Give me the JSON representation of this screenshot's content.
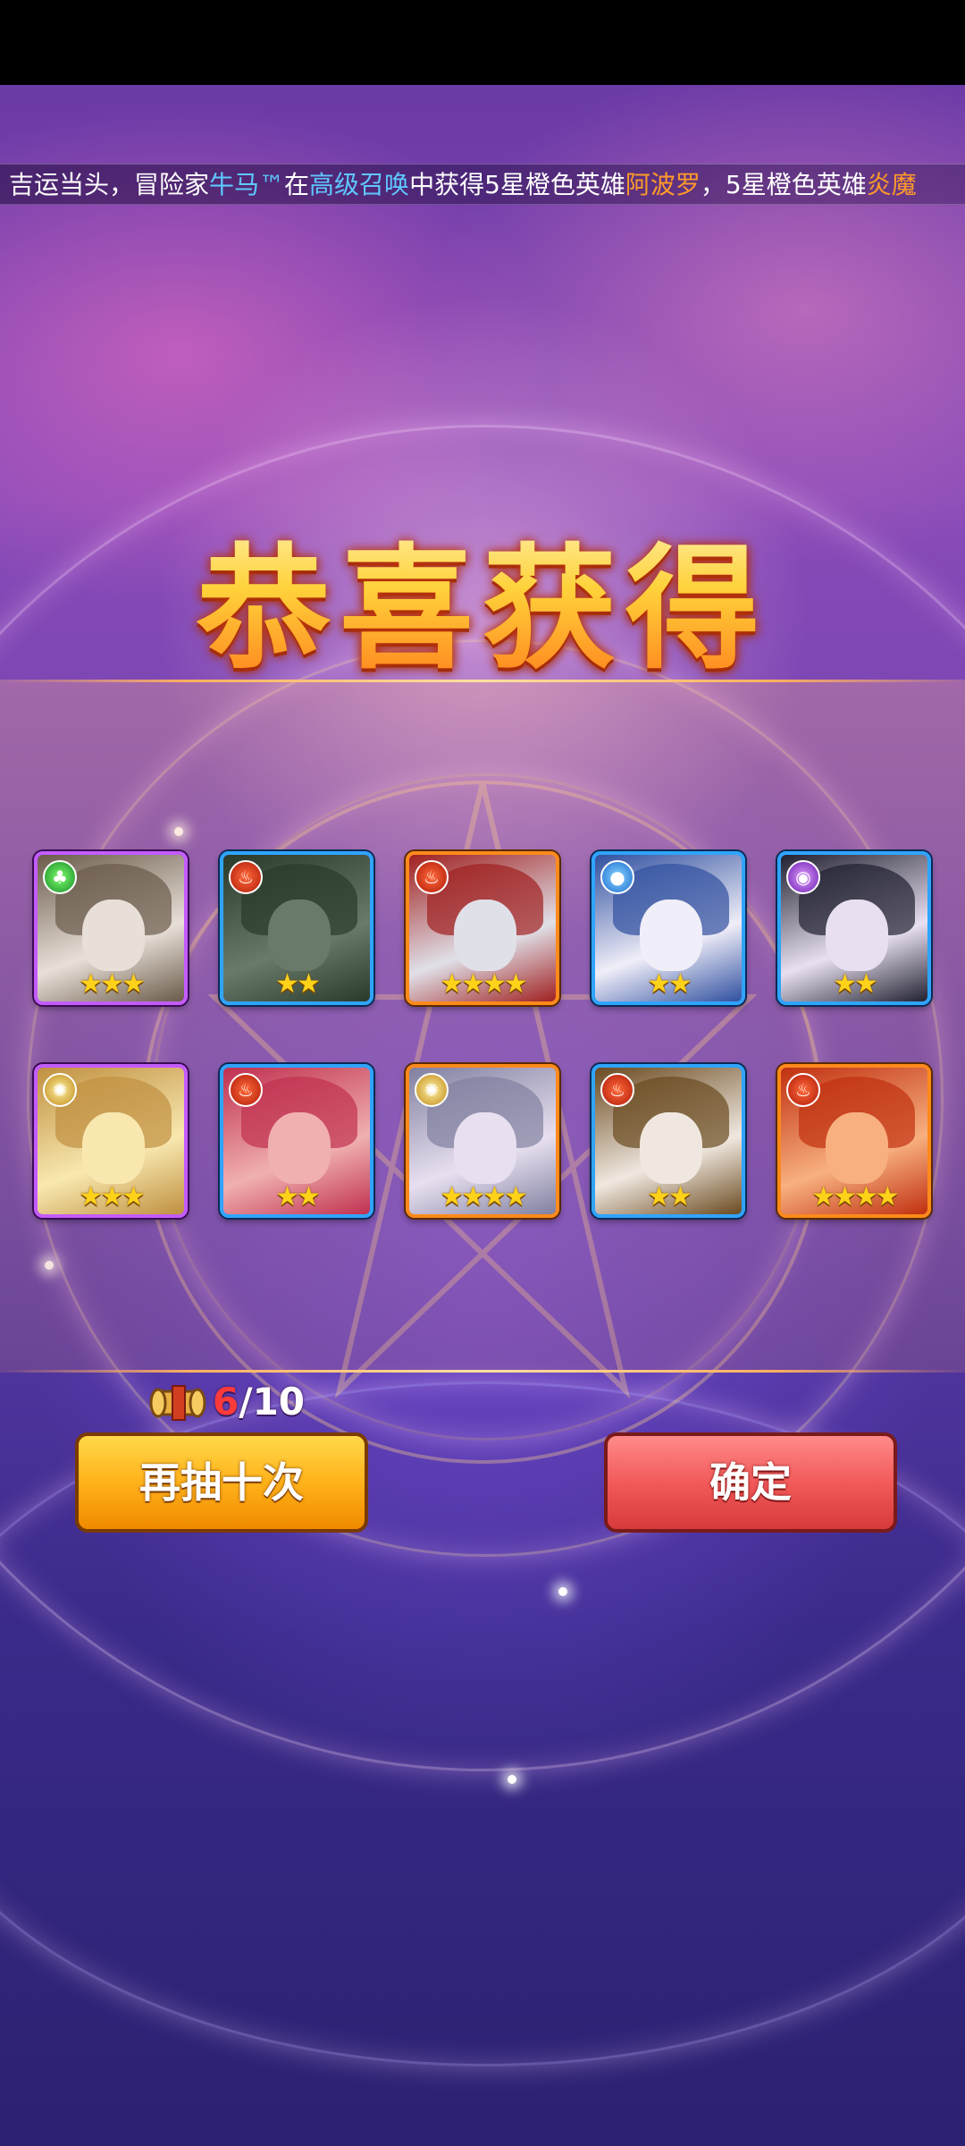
{
  "ticker": {
    "part1": "吉运当头，冒险家",
    "player": "牛马™",
    "part2": "在",
    "pool": "高级召唤",
    "part3": "中获得5星橙色英雄",
    "hero1": "阿波罗",
    "part4": "，5星橙色英雄",
    "hero2": "炎魔"
  },
  "title": "恭喜获得",
  "heroes": [
    {
      "element": "nature-icon",
      "frame": "purple",
      "stars": "★★★",
      "star_count": 3
    },
    {
      "element": "fire-icon",
      "frame": "blue",
      "stars": "★★",
      "star_count": 2
    },
    {
      "element": "fire-icon",
      "frame": "orange",
      "stars": "★★★★",
      "star_count": 4
    },
    {
      "element": "water-icon",
      "frame": "blue",
      "stars": "★★",
      "star_count": 2
    },
    {
      "element": "dark-icon",
      "frame": "blue",
      "stars": "★★",
      "star_count": 2
    },
    {
      "element": "light-icon",
      "frame": "purple",
      "stars": "★★★",
      "star_count": 3
    },
    {
      "element": "fire-icon",
      "frame": "blue",
      "stars": "★★",
      "star_count": 2
    },
    {
      "element": "light-icon",
      "frame": "orange",
      "stars": "★★★★",
      "star_count": 4
    },
    {
      "element": "fire-icon",
      "frame": "blue",
      "stars": "★★",
      "star_count": 2
    },
    {
      "element": "fire-icon",
      "frame": "orange",
      "stars": "★★★★",
      "star_count": 4
    }
  ],
  "scrolls": {
    "current": "6",
    "separator": "/",
    "total": "10"
  },
  "buttons": {
    "draw_again": "再抽十次",
    "confirm": "确定"
  },
  "colors": {
    "frame_blue": "#2fa4ff",
    "frame_purple": "#c35cff",
    "frame_orange": "#ff8a1a",
    "draw_button": "#ffb21a",
    "confirm_button": "#f25a5a",
    "ticker_highlight_blue": "#5fc8ff",
    "ticker_highlight_orange": "#ff9a2a"
  }
}
